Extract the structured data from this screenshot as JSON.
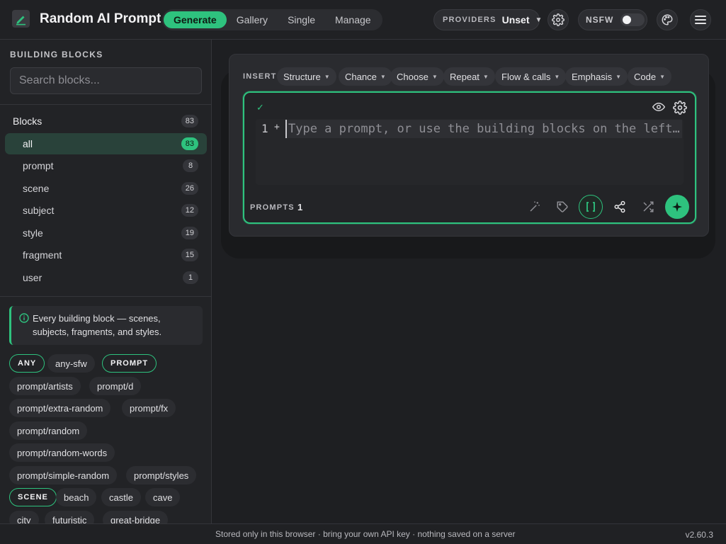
{
  "header": {
    "app_title": "Random AI Prompt",
    "nav_tabs": [
      {
        "label": "Generate",
        "active": true
      },
      {
        "label": "Gallery",
        "active": false
      },
      {
        "label": "Single",
        "active": false
      },
      {
        "label": "Manage",
        "active": false
      }
    ],
    "providers_label": "PROVIDERS",
    "providers_value": "Unset",
    "nsfw_label": "NSFW",
    "nsfw_enabled": false,
    "accent_color": "#2ec27e"
  },
  "sidebar": {
    "heading": "BUILDING BLOCKS",
    "search_placeholder": "Search blocks...",
    "blocks_title": "Blocks",
    "blocks_total": "83",
    "blocks": [
      {
        "label": "all",
        "count": "83",
        "active": true
      },
      {
        "label": "prompt",
        "count": "8"
      },
      {
        "label": "scene",
        "count": "26"
      },
      {
        "label": "subject",
        "count": "12"
      },
      {
        "label": "style",
        "count": "19"
      },
      {
        "label": "fragment",
        "count": "15"
      },
      {
        "label": "user",
        "count": "1"
      }
    ],
    "info_text": "Every building block — scenes, subjects, fragments, and styles.",
    "tags": [
      {
        "label": "ANY",
        "group": true
      },
      {
        "label": "any-sfw"
      },
      {
        "label": "PROMPT",
        "group": true
      },
      {
        "label": "prompt/artists"
      },
      {
        "label": "prompt/d"
      },
      {
        "label": "prompt/extra-random"
      },
      {
        "label": "prompt/fx"
      },
      {
        "label": "prompt/random"
      },
      {
        "label": "prompt/random-words"
      },
      {
        "label": "prompt/simple-random"
      },
      {
        "label": "prompt/styles"
      },
      {
        "label": "SCENE",
        "group": true
      },
      {
        "label": "beach"
      },
      {
        "label": "castle"
      },
      {
        "label": "cave"
      },
      {
        "label": "city"
      },
      {
        "label": "futuristic"
      },
      {
        "label": "great-bridge"
      }
    ]
  },
  "editor": {
    "insert_label": "INSERT",
    "insert_menus": [
      "Structure",
      "Chance",
      "Choose",
      "Repeat",
      "Flow & calls",
      "Emphasis",
      "Code"
    ],
    "check_glyph": "✓",
    "line_number": "1",
    "line_plus": "+",
    "placeholder": "Type a prompt, or use the building blocks on the left…",
    "prompts_label": "PROMPTS",
    "prompts_count": "1"
  },
  "footer": {
    "note": "Stored only in this browser · bring your own API key · nothing saved on a server",
    "version": "v2.60.3"
  }
}
